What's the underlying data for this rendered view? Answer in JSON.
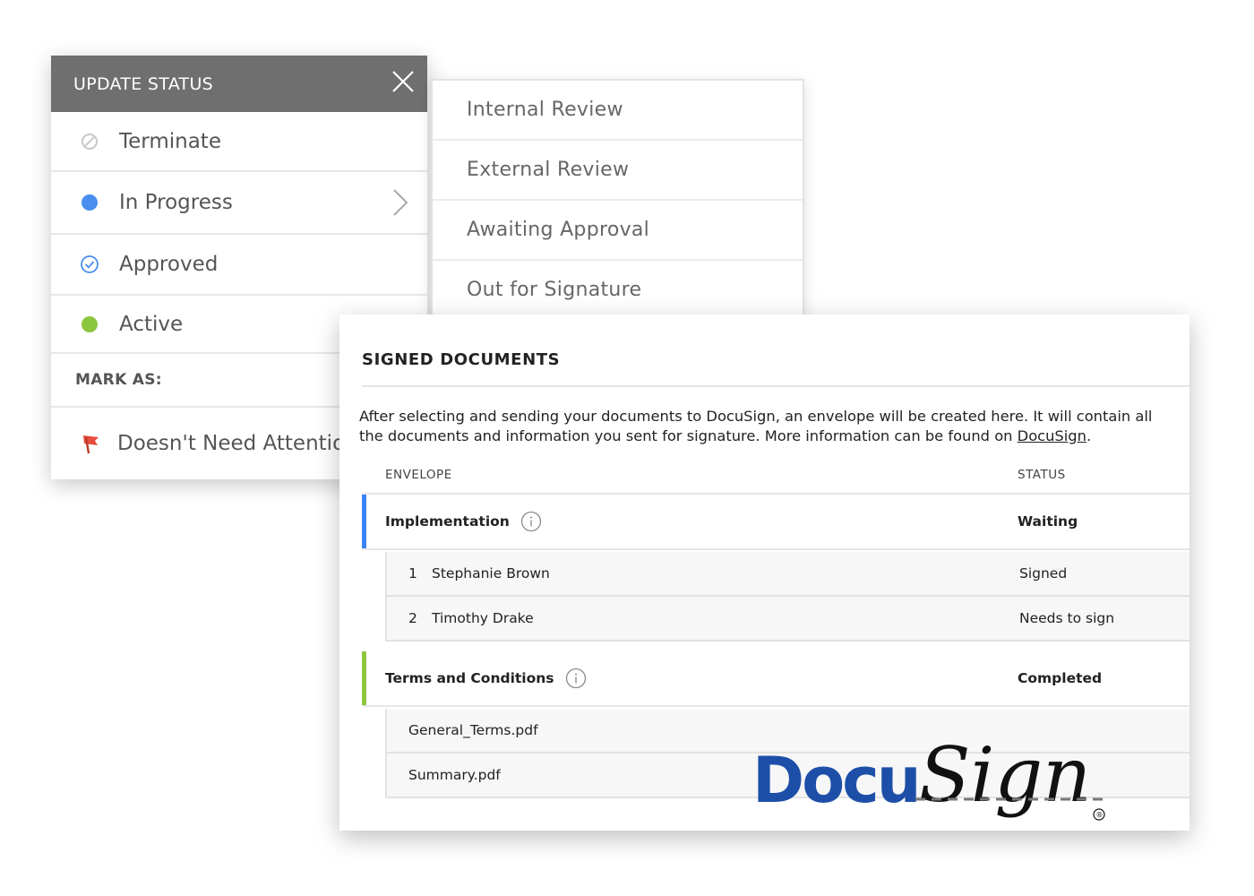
{
  "update_status": {
    "title": "UPDATE STATUS",
    "items": [
      {
        "label": "Terminate",
        "icon": "terminate-icon"
      },
      {
        "label": "In Progress",
        "icon": "blue-dot-icon",
        "color": "#4a8ef0"
      },
      {
        "label": "Approved",
        "icon": "check-circle-icon",
        "color": "#4a8ef0"
      },
      {
        "label": "Active",
        "icon": "green-dot-icon",
        "color": "#8cc63f"
      }
    ],
    "mark_as_label": "MARK AS:",
    "flag_item": {
      "label": "Doesn't Need Attention",
      "icon": "flag-icon",
      "color": "#e74c3c"
    }
  },
  "submenu": {
    "items": [
      "Internal Review",
      "External Review",
      "Awaiting Approval",
      "Out for Signature"
    ]
  },
  "signed_documents": {
    "title": "SIGNED DOCUMENTS",
    "description": "After selecting and sending your documents to DocuSign, an envelope will be created here. It will contain all the documents and information you sent for signature. More information can be found on ",
    "description_link": "DocuSign",
    "description_end": ".",
    "columns": {
      "envelope": "ENVELOPE",
      "status": "STATUS"
    },
    "envelopes": [
      {
        "name": "Implementation",
        "status": "Waiting",
        "accent": "#3b82f6",
        "signers": [
          {
            "num": "1",
            "name": "Stephanie Brown",
            "status": "Signed"
          },
          {
            "num": "2",
            "name": "Timothy Drake",
            "status": "Needs to sign"
          }
        ]
      },
      {
        "name": "Terms and Conditions",
        "status": "Completed",
        "accent": "#8cc63f",
        "files": [
          "General_Terms.pdf",
          "Summary.pdf"
        ]
      }
    ]
  },
  "logo": {
    "text_a": "Docu",
    "text_b": "Sign",
    "mark": "®",
    "color": "#1e4fa8"
  }
}
